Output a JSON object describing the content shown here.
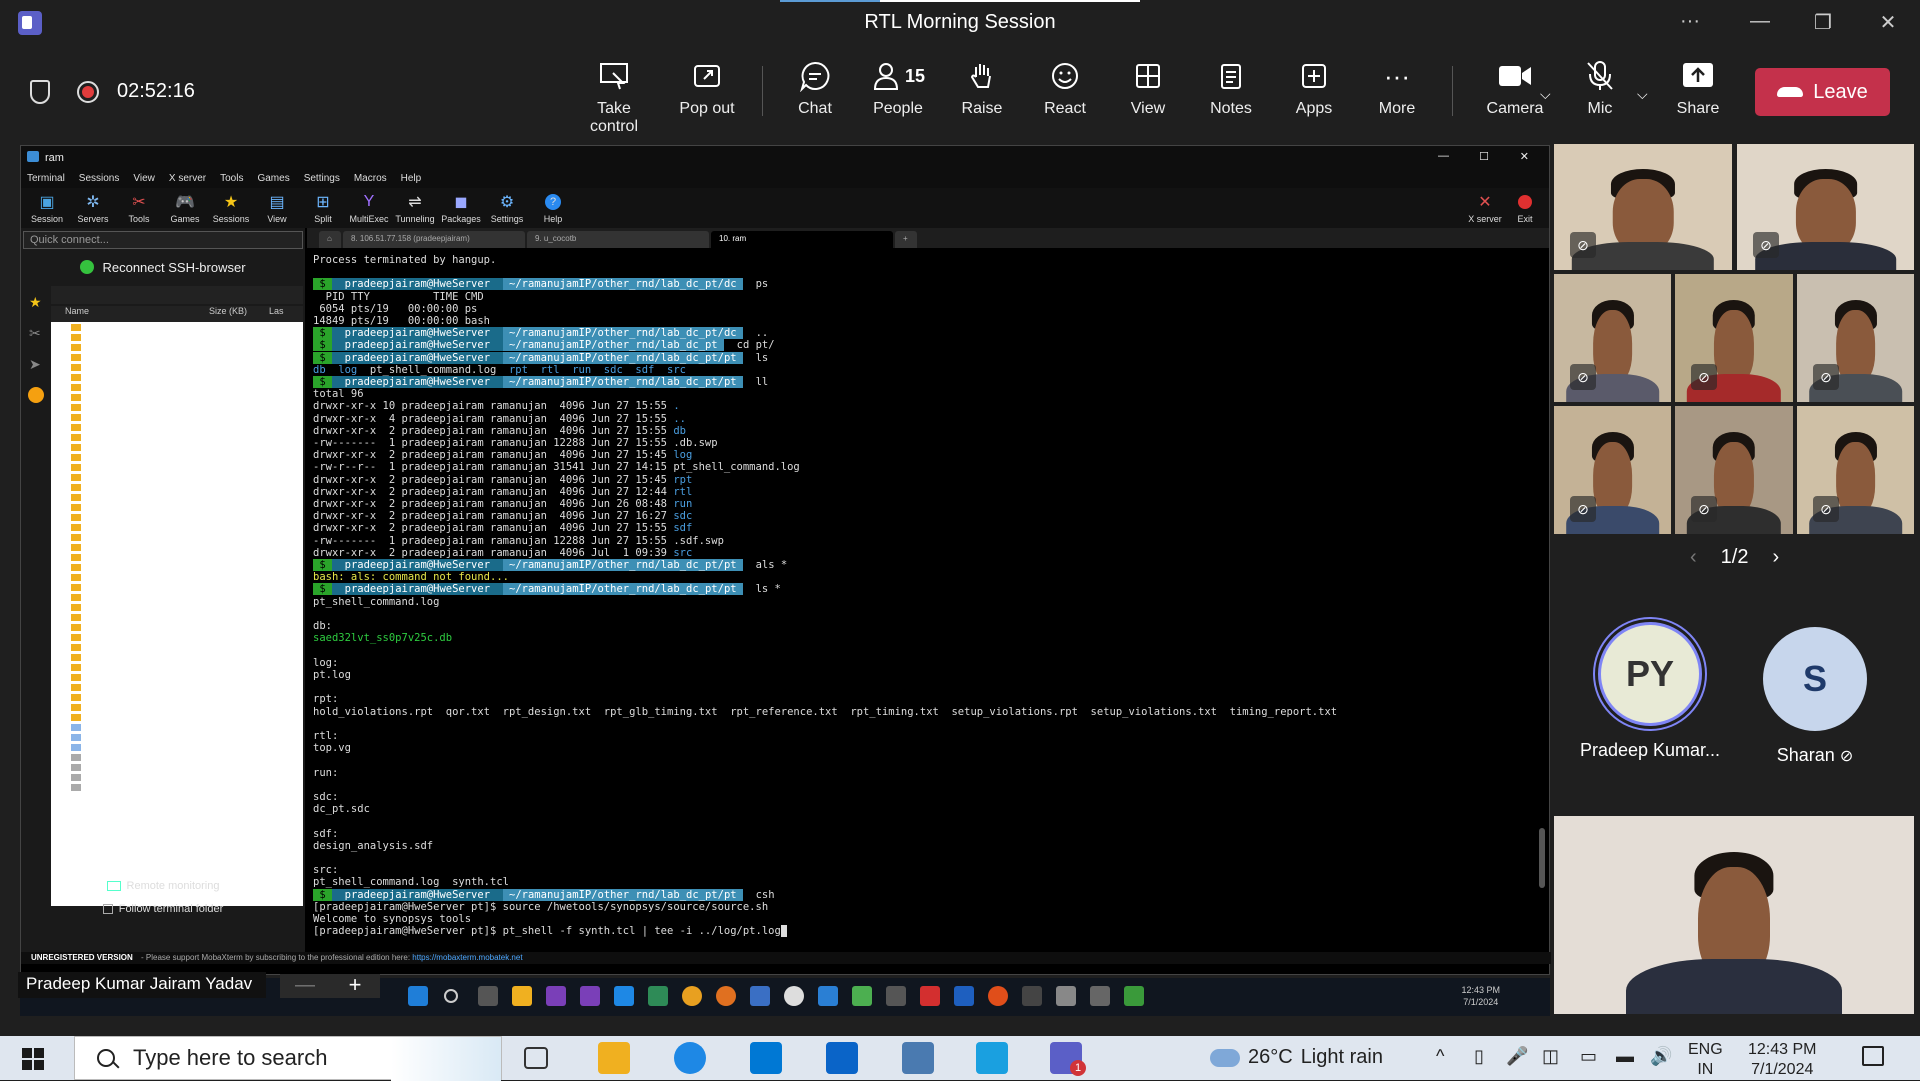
{
  "app": {
    "title": "RTL Morning Session"
  },
  "meeting": {
    "timer": "02:52:16",
    "toolbar": [
      {
        "label": "Take control",
        "icon": "take-control-icon"
      },
      {
        "label": "Pop out",
        "icon": "pop-out-icon"
      },
      {
        "label": "Chat",
        "icon": "chat-icon"
      },
      {
        "label": "People",
        "icon": "people-icon",
        "count": "15"
      },
      {
        "label": "Raise",
        "icon": "raise-hand-icon"
      },
      {
        "label": "React",
        "icon": "react-icon"
      },
      {
        "label": "View",
        "icon": "view-icon"
      },
      {
        "label": "Notes",
        "icon": "notes-icon"
      },
      {
        "label": "Apps",
        "icon": "apps-icon"
      },
      {
        "label": "More",
        "icon": "more-icon"
      },
      {
        "label": "Camera",
        "icon": "camera-icon"
      },
      {
        "label": "Mic",
        "icon": "mic-off-icon"
      },
      {
        "label": "Share",
        "icon": "share-icon"
      }
    ],
    "leave": "Leave",
    "presenter": "Pradeep Kumar Jairam Yadav",
    "pager": "1/2",
    "participants": [
      {
        "initials": "PY",
        "name": "Pradeep Kumar...",
        "color": "#e8ead6"
      },
      {
        "initials": "S",
        "name": "Sharan",
        "color": "#c7d6ec"
      }
    ]
  },
  "mobaxterm": {
    "window_title": "ram",
    "menu": [
      "Terminal",
      "Sessions",
      "View",
      "X server",
      "Tools",
      "Games",
      "Settings",
      "Macros",
      "Help"
    ],
    "tools": [
      "Session",
      "Servers",
      "Tools",
      "Games",
      "Sessions",
      "View",
      "Split",
      "MultiExec",
      "Tunneling",
      "Packages",
      "Settings",
      "Help"
    ],
    "right_tools": [
      "X server",
      "Exit"
    ],
    "quick_connect": "Quick connect...",
    "reconnect": "Reconnect SSH-browser",
    "file_headers": [
      "Name",
      "Size (KB)",
      "Las"
    ],
    "remote_monitoring": "Remote monitoring",
    "follow_folder": "Follow terminal folder",
    "tabs": [
      "8. 106.51.77.158 (pradeepjairam)",
      "9. u_cocotb",
      "10. ram"
    ],
    "status_unregistered": "UNREGISTERED VERSION",
    "status_text": " -  Please support MobaXterm by subscribing to the professional edition here: ",
    "status_link": "https://mobaxterm.mobatek.net"
  },
  "terminal": {
    "hangup": "Process terminated by hangup.",
    "user": "pradeepjairam@HweServer",
    "path_dc": "~/ramanujamIP/other_rnd/lab_dc_pt/dc",
    "path_pt": "~/ramanujamIP/other_rnd/lab_dc_pt",
    "path_ptpt": "~/ramanujamIP/other_rnd/lab_dc_pt/pt",
    "cmd_ps": "ps",
    "ps_header": "  PID TTY          TIME CMD",
    "ps_1": " 6054 pts/19   00:00:00 ps",
    "ps_2": "14849 pts/19   00:00:00 bash",
    "cmd_dotdot": "..",
    "cmd_cd": "cd pt/",
    "cmd_ls": "ls",
    "ls_out_pre": "db  log  ",
    "ls_out_mid": "pt_shell_command.log",
    "ls_out_post": "  rpt  rtl  run  sdc  sdf  src",
    "cmd_ll": "ll",
    "total": "total 96",
    "ll_rows": [
      [
        "drwxr-xr-x 10 pradeepjairam ramanujan  4096 Jun 27 15:55 ",
        "."
      ],
      [
        "drwxr-xr-x  4 pradeepjairam ramanujan  4096 Jun 27 15:55 ",
        ".."
      ],
      [
        "drwxr-xr-x  2 pradeepjairam ramanujan  4096 Jun 27 15:55 ",
        "db"
      ],
      [
        "-rw-------  1 pradeepjairam ramanujan 12288 Jun 27 15:55 ",
        ".db.swp"
      ],
      [
        "drwxr-xr-x  2 pradeepjairam ramanujan  4096 Jun 27 15:45 ",
        "log"
      ],
      [
        "-rw-r--r--  1 pradeepjairam ramanujan 31541 Jun 27 14:15 ",
        "pt_shell_command.log"
      ],
      [
        "drwxr-xr-x  2 pradeepjairam ramanujan  4096 Jun 27 15:45 ",
        "rpt"
      ],
      [
        "drwxr-xr-x  2 pradeepjairam ramanujan  4096 Jun 27 12:44 ",
        "rtl"
      ],
      [
        "drwxr-xr-x  2 pradeepjairam ramanujan  4096 Jun 26 08:48 ",
        "run"
      ],
      [
        "drwxr-xr-x  2 pradeepjairam ramanujan  4096 Jun 27 16:27 ",
        "sdc"
      ],
      [
        "drwxr-xr-x  2 pradeepjairam ramanujan  4096 Jun 27 15:55 ",
        "sdf"
      ],
      [
        "-rw-------  1 pradeepjairam ramanujan 12288 Jun 27 15:55 ",
        ".sdf.swp"
      ],
      [
        "drwxr-xr-x  2 pradeepjairam ramanujan  4096 Jul  1 09:39 ",
        "src"
      ]
    ],
    "cmd_als": "als *",
    "als_err": "bash: als: command not found...",
    "cmd_ls_star": "ls *",
    "f_pt": "pt_shell_command.log",
    "db_h": "db:",
    "db_v": "saed32lvt_ss0p7v25c.db",
    "log_h": "log:",
    "log_v": "pt.log",
    "rpt_h": "rpt:",
    "rpt_v": "hold_violations.rpt  qor.txt  rpt_design.txt  rpt_glb_timing.txt  rpt_reference.txt  rpt_timing.txt  setup_violations.rpt  setup_violations.txt  timing_report.txt",
    "rtl_h": "rtl:",
    "rtl_v": "top.vg",
    "run_h": "run:",
    "sdc_h": "sdc:",
    "sdc_v": "dc_pt.sdc",
    "sdf_h": "sdf:",
    "sdf_v": "design_analysis.sdf",
    "src_h": "src:",
    "src_v": "pt_shell_command.log  synth.tcl",
    "cmd_csh": "csh",
    "src_line": "[pradeepjairam@HweServer pt]$ source /hwetools/synopsys/source/source.sh",
    "welcome": "Welcome to synopsys tools",
    "last_line": "[pradeepjairam@HweServer pt]$ pt_shell -f synth.tcl | tee -i ../log/pt.log"
  },
  "remote_taskbar": {
    "time": "12:43 PM",
    "date": "7/1/2024"
  },
  "windows": {
    "search_placeholder": "Type here to search",
    "temperature": "26°C",
    "weather": "Light rain",
    "lang1": "ENG",
    "lang2": "IN",
    "time": "12:43 PM",
    "date": "7/1/2024",
    "teams_badge": "1"
  }
}
